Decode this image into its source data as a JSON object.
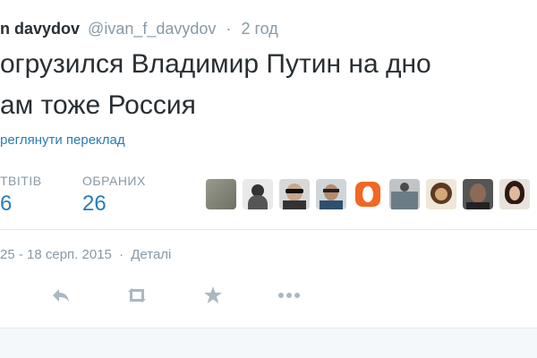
{
  "tweet": {
    "user_name": "n davydov",
    "handle": "@ivan_f_davydov",
    "time": "2 год",
    "text_line1": "огрузился Владимир Путин на дно",
    "text_line2": "ам тоже Россия",
    "translate_link": "реглянути переклад"
  },
  "stats": {
    "retweets_label": "ТВІТІВ",
    "retweets_value": "6",
    "favorites_label": "ОБРАНИХ",
    "favorites_value": "26"
  },
  "meta": {
    "timestamp": "25 - 18 серп. 2015",
    "separator": "·",
    "details_link": "Деталі"
  },
  "colors": {
    "link": "#2b7bb9",
    "muted": "#8899a6",
    "text": "#292f33",
    "divider": "#e1e8ed"
  },
  "icons": [
    "reply-icon",
    "retweet-icon",
    "favorite-icon",
    "more-icon"
  ]
}
